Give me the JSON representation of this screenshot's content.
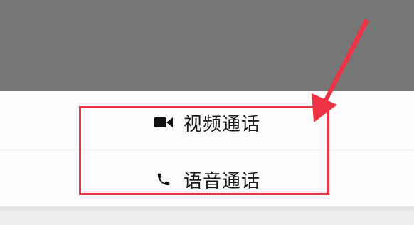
{
  "call_menu": {
    "video_call_label": "视频通话",
    "voice_call_label": "语音通话",
    "video_icon": "video-camera-icon",
    "voice_icon": "phone-handset-icon"
  },
  "annotation": {
    "highlight_color": "#ee3344",
    "arrow_color": "#ee3344"
  },
  "colors": {
    "overlay": "#767676",
    "sheet_background": "#fbfbfb",
    "text": "#1a1a1a"
  }
}
